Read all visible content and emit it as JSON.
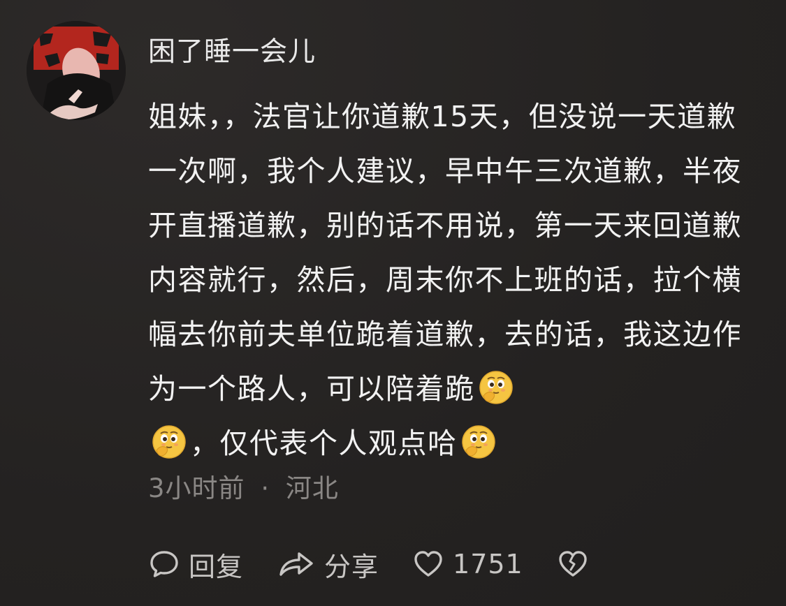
{
  "comment": {
    "username": "困了睡一会儿",
    "text_before_emoji_1": "姐妹，，法官让你道歉15天，但没说一天道歉一次啊，我个人建议，早中午三次道歉，半夜开直播道歉，别的话不用说，第一天来回道歉内容就行，然后，周末你不上班的话，拉个横幅去你前夫单位跪着道歉，去的话，我这边作为一个路人，可以陪着跪",
    "text_between_emoji": "，仅代表个人观点哈",
    "emoji_name": "thinking-face-emoji",
    "time": "3小时前",
    "separator": "·",
    "location": "河北"
  },
  "actions": {
    "reply_label": "回复",
    "share_label": "分享",
    "like_count": "1751"
  },
  "colors": {
    "background": "#262423",
    "text": "#f2f2f2",
    "meta": "#8a8785",
    "action": "#c8c6c4"
  }
}
